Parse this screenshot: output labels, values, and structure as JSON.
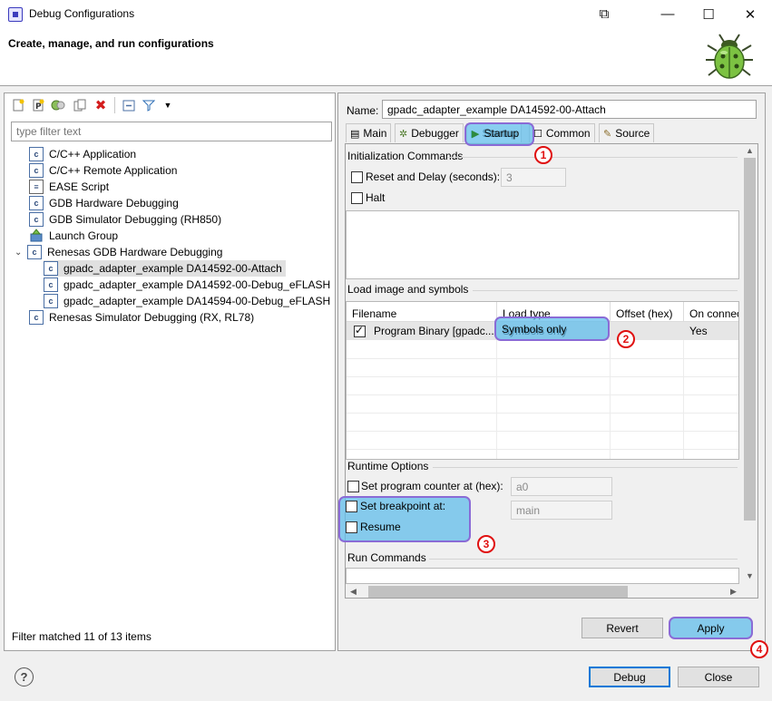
{
  "window": {
    "title": "Debug Configurations",
    "minimize": "—",
    "restore": "⧉",
    "maximize": "☐",
    "close": "✕"
  },
  "header": {
    "title": "Create, manage, and run configurations"
  },
  "toolbar": {
    "icons": [
      "new-configuration-icon",
      "new-prototype-icon",
      "export-icon",
      "duplicate-icon",
      "delete-icon",
      "collapse-all-icon",
      "filter-icon",
      "dropdown-icon"
    ]
  },
  "filter": {
    "placeholder": "type filter text",
    "status": "Filter matched 11 of 13 items"
  },
  "tree": {
    "items": [
      {
        "label": "C/C++ Application",
        "icon": "c"
      },
      {
        "label": "C/C++ Remote Application",
        "icon": "c"
      },
      {
        "label": "EASE Script",
        "icon": "ease"
      },
      {
        "label": "GDB Hardware Debugging",
        "icon": "c"
      },
      {
        "label": "GDB Simulator Debugging (RH850)",
        "icon": "c"
      },
      {
        "label": "Launch Group",
        "icon": "launch"
      },
      {
        "label": "Renesas GDB Hardware Debugging",
        "icon": "c"
      },
      {
        "label": "gpadc_adapter_example DA14592-00-Attach",
        "icon": "c"
      },
      {
        "label": "gpadc_adapter_example DA14592-00-Debug_eFLASH",
        "icon": "c"
      },
      {
        "label": "gpadc_adapter_example DA14594-00-Debug_eFLASH",
        "icon": "c"
      },
      {
        "label": "Renesas Simulator Debugging (RX, RL78)",
        "icon": "c"
      }
    ]
  },
  "config": {
    "name_label": "Name:",
    "name_value": "gpadc_adapter_example DA14592-00-Attach",
    "tabs": [
      {
        "label": "Main",
        "icon": "main-tab-icon"
      },
      {
        "label": "Debugger",
        "icon": "debugger-tab-icon"
      },
      {
        "label": "Startup",
        "icon": "startup-tab-icon"
      },
      {
        "label": "Common",
        "icon": "common-tab-icon"
      },
      {
        "label": "Source",
        "icon": "source-tab-icon"
      }
    ],
    "init": {
      "title": "Initialization Commands",
      "reset_label": "Reset and Delay (seconds):",
      "reset_checked": false,
      "reset_value": "3",
      "halt_label": "Halt",
      "halt_checked": false
    },
    "load": {
      "title": "Load image and symbols",
      "columns": [
        "Filename",
        "Load type",
        "Offset (hex)",
        "On connect"
      ],
      "rows": [
        {
          "checked": true,
          "filename": "Program Binary [gpadc...",
          "load_type": "Symbols only",
          "offset": "",
          "on_connect": "Yes"
        }
      ]
    },
    "runtime": {
      "title": "Runtime Options",
      "pc_label": "Set program counter at (hex):",
      "pc_value": "a0",
      "bp_label": "Set breakpoint at:",
      "bp_value": "main",
      "resume_label": "Resume"
    },
    "run_commands": {
      "title": "Run Commands"
    }
  },
  "buttons": {
    "revert": "Revert",
    "apply": "Apply",
    "debug": "Debug",
    "close": "Close"
  },
  "annotations": [
    "1",
    "2",
    "3",
    "4"
  ],
  "colors": {
    "highlight": "#62beeb",
    "highlight_border": "#8a6bd6",
    "badge": "#e01010"
  }
}
